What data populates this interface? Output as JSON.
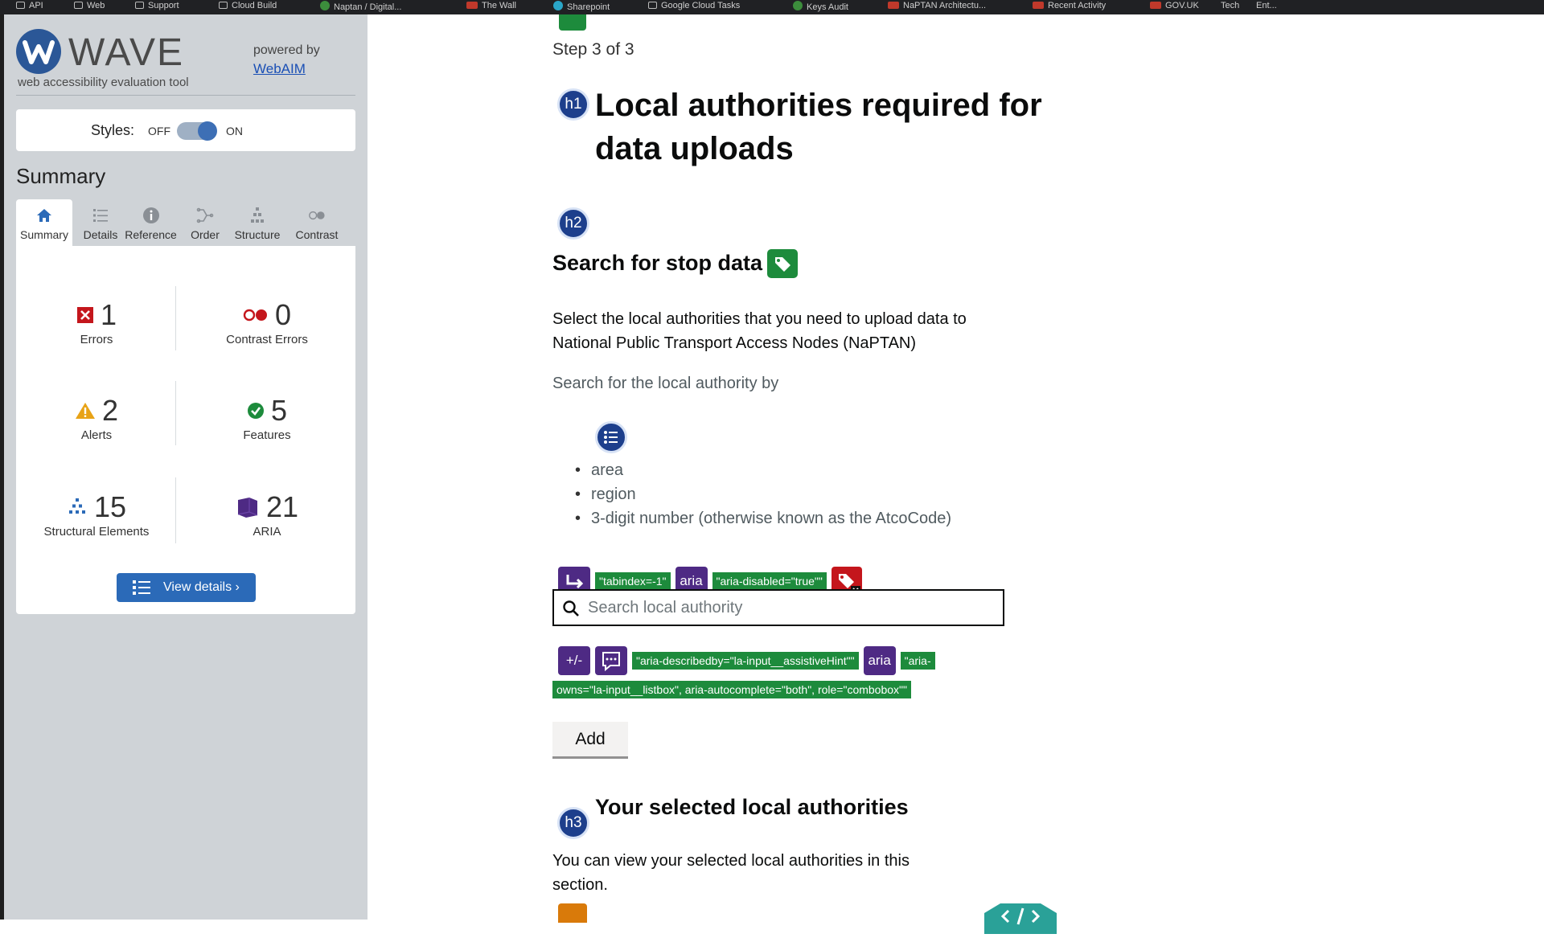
{
  "bookmarks": [
    "API",
    "Web",
    "Support",
    "Cloud Build",
    "Naptan / Digital...",
    "The Wall",
    "Sharepoint",
    "Google Cloud Tasks",
    "Keys Audit",
    "NaPTAN Architectu...",
    "Recent Activity",
    "GOV.UK",
    "Tech",
    "Ent..."
  ],
  "wave": {
    "logo_text": "WAVE",
    "tagline": "web accessibility evaluation tool",
    "powered_by": "powered by",
    "webaim_link": "WebAIM",
    "styles_label": "Styles:",
    "styles_off": "OFF",
    "styles_on": "ON",
    "summary_title": "Summary",
    "tabs": [
      {
        "label": "Summary",
        "icon": "home-icon"
      },
      {
        "label": "Details",
        "icon": "list-icon"
      },
      {
        "label": "Reference",
        "icon": "info-icon"
      },
      {
        "label": "Order",
        "icon": "order-icon"
      },
      {
        "label": "Structure",
        "icon": "structure-icon"
      },
      {
        "label": "Contrast",
        "icon": "contrast-icon"
      }
    ],
    "stats": {
      "errors": {
        "value": "1",
        "label": "Errors",
        "color": "#c4161c"
      },
      "contrast_errors": {
        "value": "0",
        "label": "Contrast Errors",
        "color": "#c4161c"
      },
      "alerts": {
        "value": "2",
        "label": "Alerts",
        "color": "#e8a317"
      },
      "features": {
        "value": "5",
        "label": "Features",
        "color": "#1d8b3c"
      },
      "structural": {
        "value": "15",
        "label": "Structural Elements",
        "color": "#2b6ab8"
      },
      "aria": {
        "value": "21",
        "label": "ARIA",
        "color": "#4e2a84"
      }
    },
    "view_details": "View details ›"
  },
  "page": {
    "step": "Step 3 of 3",
    "h1_icon": "h1",
    "h1": "Local authorities required for data uploads",
    "h2_icon": "h2",
    "h2": "Search for stop data",
    "intro": "Select the local authorities that you need to upload data to National Public Transport Access Nodes (NaPTAN)",
    "hint": "Search for the local authority by",
    "list_items": [
      "area",
      "region",
      "3-digit number (otherwise known as the AtcoCode)"
    ],
    "aria_row1": {
      "tabindex": "\"tabindex=-1\"",
      "aria_badge": "aria",
      "aria_disabled": "\"aria-disabled=\"true\"\""
    },
    "search_placeholder": "Search local authority",
    "aria_row2": {
      "plusminus": "+/-",
      "describedby": "\"aria-describedby=\"la-input__assistiveHint\"\"",
      "aria_badge": "aria",
      "aria_start": "\"aria-",
      "aria_cont": "owns=\"la-input__listbox\", aria-autocomplete=\"both\", role=\"combobox\"\""
    },
    "add_button": "Add",
    "h3_icon": "h3",
    "h3": "Your selected local authorities",
    "selected_text": "You can view your selected local authorities in this section."
  }
}
